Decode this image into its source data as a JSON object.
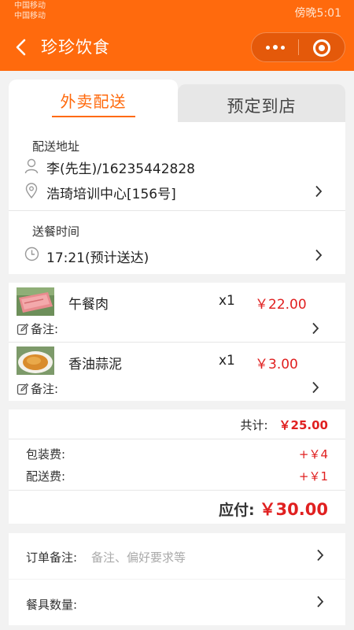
{
  "status_bar": {
    "carrier_1": "中国移动",
    "carrier_2": "中国移动",
    "time": "傍晚5:01"
  },
  "header": {
    "title": "珍珍饮食",
    "back_icon": "chevron-left-icon",
    "more_icon": "more-dots-icon",
    "close_icon": "target-close-icon"
  },
  "tabs": [
    {
      "label": "外卖配送",
      "active": true
    },
    {
      "label": "预定到店",
      "active": false
    }
  ],
  "delivery": {
    "address_label": "配送地址",
    "contact": "李(先生)/16235442828",
    "address": "浩琦培训中心[156号]",
    "time_label": "送餐时间",
    "time": "17:21(预计送达)"
  },
  "items": [
    {
      "name": "午餐肉",
      "qty": "x1",
      "price": "￥22.00",
      "note_label": "备注:"
    },
    {
      "name": "香油蒜泥",
      "qty": "x1",
      "price": "￥3.00",
      "note_label": "备注:"
    }
  ],
  "totals": {
    "subtotal_label": "共计:",
    "subtotal": "￥25.00",
    "packing_label": "包装费:",
    "packing": "+￥4",
    "delivery_label": "配送费:",
    "delivery": "+￥1",
    "payable_label": "应付:",
    "payable": "￥30.00"
  },
  "order_remark": {
    "label": "订单备注:",
    "placeholder": "备注、偏好要求等"
  },
  "utensils": {
    "label": "餐具数量:"
  },
  "colors": {
    "brand": "#ff6a0d",
    "price": "#e02020"
  }
}
